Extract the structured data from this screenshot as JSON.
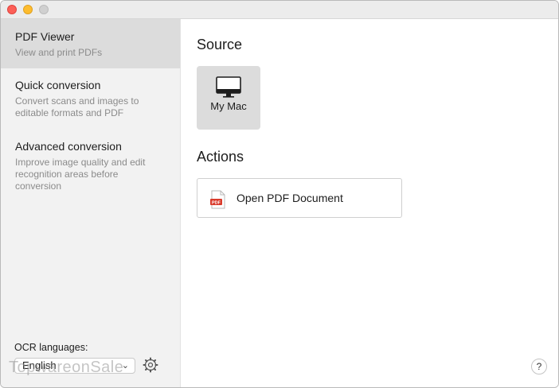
{
  "window": {
    "controls": [
      "close",
      "minimize",
      "maximize"
    ]
  },
  "sidebar": {
    "items": [
      {
        "title": "PDF Viewer",
        "description": "View and print PDFs",
        "selected": true
      },
      {
        "title": "Quick conversion",
        "description": "Convert scans and images to editable formats and PDF",
        "selected": false
      },
      {
        "title": "Advanced conversion",
        "description": "Improve image quality and edit recognition areas before conversion",
        "selected": false
      }
    ],
    "ocr_label": "OCR languages:",
    "ocr_language": "English",
    "watermark": "TopwareonSale"
  },
  "main": {
    "source_heading": "Source",
    "source_tile": {
      "label": "My Mac",
      "icon": "monitor-icon"
    },
    "actions_heading": "Actions",
    "action": {
      "label": "Open PDF Document",
      "icon": "pdf-file-icon"
    },
    "help_label": "?"
  },
  "colors": {
    "sidebar_bg": "#f2f2f2",
    "selected_bg": "#dcdcdc",
    "pdf_red": "#d93a2b"
  }
}
